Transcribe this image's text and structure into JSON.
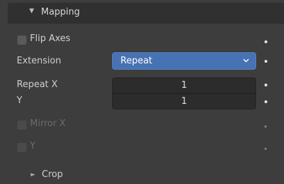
{
  "panel": {
    "title": "Mapping",
    "expanded_glyph": "▼",
    "collapsed_glyph": "►"
  },
  "flip_axes": {
    "label": "Flip Axes",
    "checked": false
  },
  "extension": {
    "label": "Extension",
    "value": "Repeat"
  },
  "repeat": {
    "x_label": "Repeat X",
    "y_label": "Y",
    "x_value": "1",
    "y_value": "1"
  },
  "mirror": {
    "x_label": "Mirror X",
    "y_label": "Y",
    "enabled": false
  },
  "crop": {
    "label": "Crop"
  },
  "colors": {
    "background": "#3d3d3d",
    "header": "#303030",
    "dropdown_accent": "#4772b3",
    "field": "#2c2c2c"
  }
}
